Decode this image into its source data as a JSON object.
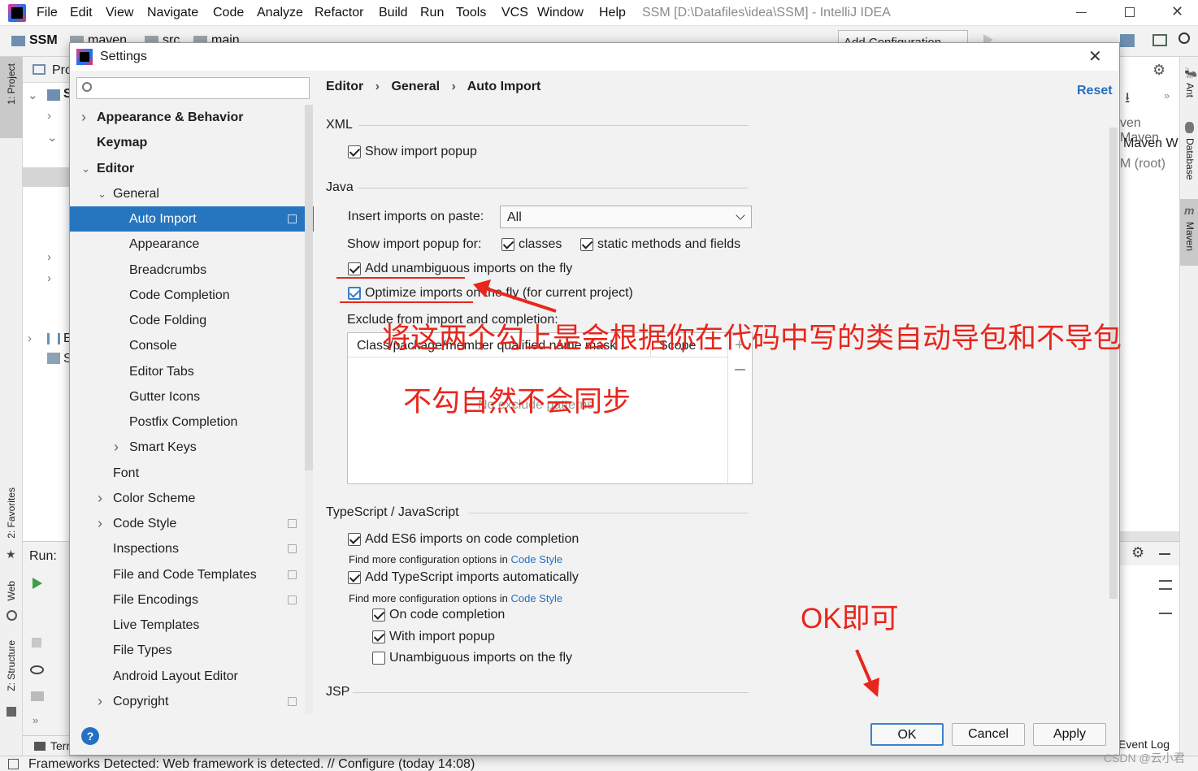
{
  "window": {
    "title": "SSM [D:\\Datafiles\\idea\\SSM] - IntelliJ IDEA",
    "menu": [
      "File",
      "Edit",
      "View",
      "Navigate",
      "Code",
      "Analyze",
      "Refactor",
      "Build",
      "Run",
      "Tools",
      "VCS",
      "Window",
      "Help"
    ],
    "breadcrumbs": [
      "SSM",
      "maven",
      "src",
      "main"
    ],
    "add_configuration": "Add Configuration..."
  },
  "tool_windows": {
    "left": [
      "1: Project",
      "2: Favorites",
      "Web",
      "Z: Structure"
    ],
    "right": [
      "Ant",
      "Database",
      "Maven"
    ],
    "project_header": "Pro",
    "project_rows": [
      "S",
      "E",
      "S"
    ],
    "run_label": "Run:",
    "terminal": "Terr",
    "maven_items": [
      "ven Maven",
      "Maven W",
      "M (root)"
    ],
    "event_log": "Event Log"
  },
  "status_bar": {
    "text": "Frameworks Detected: Web framework is detected. // Configure (today 14:08)"
  },
  "dialog": {
    "title": "Settings",
    "search_placeholder": "",
    "breadcrumb": [
      "Editor",
      "General",
      "Auto Import"
    ],
    "reset": "Reset",
    "tree": [
      {
        "label": "Appearance & Behavior",
        "level": 0,
        "bold": true,
        "chevron": ">"
      },
      {
        "label": "Keymap",
        "level": 0,
        "bold": true,
        "chevron": ""
      },
      {
        "label": "Editor",
        "level": 0,
        "bold": true,
        "chevron": "v"
      },
      {
        "label": "General",
        "level": 1,
        "bold": false,
        "chevron": "v"
      },
      {
        "label": "Auto Import",
        "level": 2,
        "bold": false,
        "chevron": "",
        "selected": true,
        "copy": true
      },
      {
        "label": "Appearance",
        "level": 2,
        "bold": false,
        "chevron": ""
      },
      {
        "label": "Breadcrumbs",
        "level": 2,
        "bold": false,
        "chevron": ""
      },
      {
        "label": "Code Completion",
        "level": 2,
        "bold": false,
        "chevron": ""
      },
      {
        "label": "Code Folding",
        "level": 2,
        "bold": false,
        "chevron": ""
      },
      {
        "label": "Console",
        "level": 2,
        "bold": false,
        "chevron": ""
      },
      {
        "label": "Editor Tabs",
        "level": 2,
        "bold": false,
        "chevron": ""
      },
      {
        "label": "Gutter Icons",
        "level": 2,
        "bold": false,
        "chevron": ""
      },
      {
        "label": "Postfix Completion",
        "level": 2,
        "bold": false,
        "chevron": ""
      },
      {
        "label": "Smart Keys",
        "level": 2,
        "bold": false,
        "chevron": ">"
      },
      {
        "label": "Font",
        "level": 1,
        "bold": false,
        "chevron": ""
      },
      {
        "label": "Color Scheme",
        "level": 1,
        "bold": false,
        "chevron": ">"
      },
      {
        "label": "Code Style",
        "level": 1,
        "bold": false,
        "chevron": ">",
        "copy": true
      },
      {
        "label": "Inspections",
        "level": 1,
        "bold": false,
        "chevron": "",
        "copy": true
      },
      {
        "label": "File and Code Templates",
        "level": 1,
        "bold": false,
        "chevron": "",
        "copy": true
      },
      {
        "label": "File Encodings",
        "level": 1,
        "bold": false,
        "chevron": "",
        "copy": true
      },
      {
        "label": "Live Templates",
        "level": 1,
        "bold": false,
        "chevron": ""
      },
      {
        "label": "File Types",
        "level": 1,
        "bold": false,
        "chevron": ""
      },
      {
        "label": "Android Layout Editor",
        "level": 1,
        "bold": false,
        "chevron": ""
      },
      {
        "label": "Copyright",
        "level": 1,
        "bold": false,
        "chevron": ">",
        "copy": true
      }
    ],
    "xml": {
      "section": "XML",
      "show_import_popup": "Show import popup"
    },
    "java": {
      "section": "Java",
      "insert_imports_label": "Insert imports on paste:",
      "insert_imports_value": "All",
      "show_popup_for": "Show import popup for:",
      "classes": "classes",
      "static_methods": "static methods and fields",
      "add_unambiguous": "Add unambiguous imports on the fly",
      "optimize_imports": "Optimize imports on the fly (for current project)",
      "exclude_label": "Exclude from import and completion:",
      "col_mask": "Class/package/member qualified name mask",
      "col_scope": "Scope",
      "empty": "No exclude patterns"
    },
    "ts": {
      "section": "TypeScript / JavaScript",
      "es6": "Add ES6 imports on code completion",
      "find_more": "Find more configuration options in",
      "code_style": "Code Style",
      "ts_auto": "Add TypeScript imports automatically",
      "on_completion": "On code completion",
      "with_popup": "With import popup",
      "unambiguous": "Unambiguous imports on the fly"
    },
    "jsp": {
      "section": "JSP"
    },
    "buttons": {
      "ok": "OK",
      "cancel": "Cancel",
      "apply": "Apply",
      "help": "?"
    }
  },
  "annotations": {
    "note1": "将这两个勾上是会根据你在代码中写的类自动导包和不导包",
    "note2": "不勾自然不会同步",
    "note3": "OK即可",
    "color": "#e8261c"
  },
  "watermark": "CSDN @云小君"
}
